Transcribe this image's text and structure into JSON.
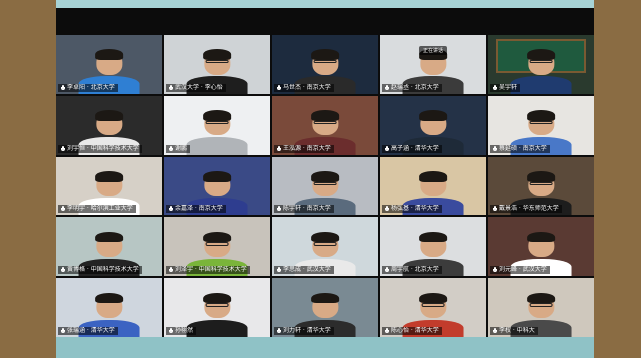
{
  "colors": {
    "frame": "#8a6c43",
    "outer_bg": "#8fc2c6",
    "meeting_bg": "#0c0c0c",
    "active_speaker": "#a7c83a",
    "muted_mic": "#e0403a"
  },
  "participants": [
    {
      "name": "李卓阳 · 北京大学",
      "bg": "#4d5866",
      "shirt": "#2f7fd3",
      "glasses": false,
      "muted": false
    },
    {
      "name": "武汉大学 · 李心怡",
      "bg": "#cfd3d6",
      "shirt": "#1e1e1e",
      "glasses": true,
      "muted": false
    },
    {
      "name": "马世杰 · 南京大学",
      "bg": "#1d2b3e",
      "shirt": "#2a2a2a",
      "glasses": true,
      "muted": false
    },
    {
      "name": "赵瑞丞 · 北京大学",
      "bg": "#d9dcde",
      "shirt": "#3b3b3b",
      "glasses": false,
      "muted": false,
      "badge": "正在讲话"
    },
    {
      "name": "吴宇轩",
      "bg": "#2a3a2e",
      "shirt": "#1f3b6f",
      "glasses": true,
      "muted": false,
      "active": true,
      "whiteboard": true
    },
    {
      "name": "刘宇恒 · 中国科学技术大学",
      "bg": "#2b2b2b",
      "shirt": "#e8e8e8",
      "glasses": false,
      "muted": false
    },
    {
      "name": "谢鹏",
      "bg": "#eef0f2",
      "shirt": "#b0b4b8",
      "glasses": true,
      "muted": false
    },
    {
      "name": "王泓源 · 南京大学",
      "bg": "#7a4a3a",
      "shirt": "#6b2d2d",
      "glasses": true,
      "muted": false
    },
    {
      "name": "高子涵 · 清华大学",
      "bg": "#243247",
      "shirt": "#1e2a38",
      "glasses": false,
      "muted": false
    },
    {
      "name": "蔡延硕 · 南京大学",
      "bg": "#e7e5e1",
      "shirt": "#4978c8",
      "glasses": true,
      "muted": false
    },
    {
      "name": "李明宇 · 哈尔滨工业大学",
      "bg": "#d6d0c7",
      "shirt": "#ffffff",
      "glasses": false,
      "muted": false
    },
    {
      "name": "余嘉泽 · 南京大学",
      "bg": "#3a4a86",
      "shirt": "#2e3d8f",
      "glasses": false,
      "muted": false
    },
    {
      "name": "陈宇轩 · 南京大学",
      "bg": "#b8bcc2",
      "shirt": "#5a6b7d",
      "glasses": true,
      "muted": false
    },
    {
      "name": "杨弘基 · 清华大学",
      "bg": "#d9c6a4",
      "shirt": "#3a4b9e",
      "glasses": false,
      "muted": false
    },
    {
      "name": "戴景浩 · 华东师范大学",
      "bg": "#5b4a3a",
      "shirt": "#1d1d1d",
      "glasses": true,
      "muted": false
    },
    {
      "name": "黄博格 · 中国科学技术大学",
      "bg": "#b7c6c4",
      "shirt": "#232323",
      "glasses": false,
      "muted": false
    },
    {
      "name": "刘泽宇 · 中国科学技术大学",
      "bg": "#c8c3bb",
      "shirt": "#7ab53a",
      "glasses": true,
      "muted": false
    },
    {
      "name": "李思成 · 武汉大学",
      "bg": "#cfd8dc",
      "shirt": "#e9e9e9",
      "glasses": true,
      "muted": false
    },
    {
      "name": "周宇航 · 北京大学",
      "bg": "#dcdee0",
      "shirt": "#3c3c3c",
      "glasses": false,
      "muted": false
    },
    {
      "name": "刘元峰 · 武汉大学",
      "bg": "#5a3a33",
      "shirt": "#ffffff",
      "glasses": false,
      "muted": false
    },
    {
      "name": "张瑞涵 · 清华大学",
      "bg": "#cfd6de",
      "shirt": "#3b63c2",
      "glasses": false,
      "muted": false
    },
    {
      "name": "孙栩然",
      "bg": "#e8e8ea",
      "shirt": "#1d1d1d",
      "glasses": true,
      "muted": false
    },
    {
      "name": "刘力轩 · 清华大学",
      "bg": "#7a8a93",
      "shirt": "#2c2c2c",
      "glasses": false,
      "muted": false
    },
    {
      "name": "陈心怡 · 清华大学",
      "bg": "#d2cdc6",
      "shirt": "#c23c2c",
      "glasses": true,
      "muted": false
    },
    {
      "name": "李权 · 中科大",
      "bg": "#cfc8bd",
      "shirt": "#4a4a4a",
      "glasses": true,
      "muted": false
    }
  ]
}
